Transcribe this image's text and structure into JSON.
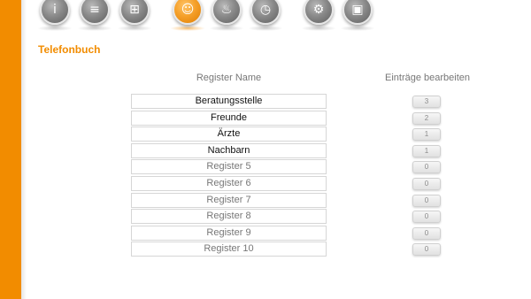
{
  "app": {
    "page_title": "Telefonbuch"
  },
  "nav_icons": [
    {
      "name": "info-icon",
      "glyph": "i",
      "active": false
    },
    {
      "name": "system-icon",
      "glyph": "≡",
      "active": false
    },
    {
      "name": "network-icon",
      "glyph": "⊞",
      "active": false
    },
    {
      "name": "phonebook-icon",
      "glyph": "☺",
      "active": true
    },
    {
      "name": "fire-icon",
      "glyph": "♨",
      "active": false
    },
    {
      "name": "alarm-clock-icon",
      "glyph": "◷",
      "active": false
    },
    {
      "name": "settings-sliders-icon",
      "glyph": "⚙",
      "active": false
    },
    {
      "name": "monitor-icon",
      "glyph": "▣",
      "active": false
    }
  ],
  "table": {
    "header_name": "Register Name",
    "header_edit": "Einträge bearbeiten",
    "registers": [
      {
        "name": "Beratungsstelle",
        "count": "3",
        "filled": true
      },
      {
        "name": "Freunde",
        "count": "2",
        "filled": true
      },
      {
        "name": "Ärzte",
        "count": "1",
        "filled": true
      },
      {
        "name": "Nachbarn",
        "count": "1",
        "filled": true
      },
      {
        "name": "Register 5",
        "count": "0",
        "filled": false
      },
      {
        "name": "Register 6",
        "count": "0",
        "filled": false
      },
      {
        "name": "Register 7",
        "count": "0",
        "filled": false
      },
      {
        "name": "Register 8",
        "count": "0",
        "filled": false
      },
      {
        "name": "Register 9",
        "count": "0",
        "filled": false
      },
      {
        "name": "Register 10",
        "count": "0",
        "filled": false
      }
    ]
  },
  "colors": {
    "accent": "#f28c00",
    "sidebar": "#f28c00"
  }
}
